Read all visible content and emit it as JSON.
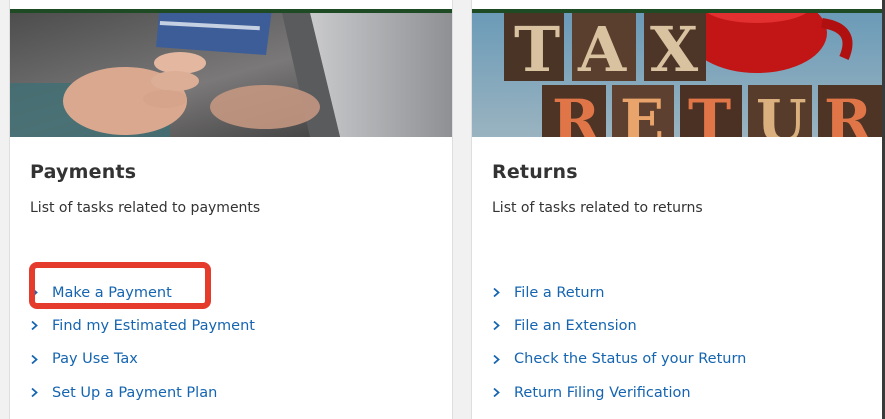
{
  "cards": [
    {
      "title": "Payments",
      "subtitle": "List of tasks related to payments",
      "image": "credit-card-laptop-photo",
      "tasks": [
        {
          "label": "Make a Payment",
          "highlighted": true
        },
        {
          "label": "Find my Estimated Payment"
        },
        {
          "label": "Pay Use Tax"
        },
        {
          "label": "Set Up a Payment Plan"
        }
      ]
    },
    {
      "title": "Returns",
      "subtitle": "List of tasks related to returns",
      "image": "tax-return-wooden-letters-photo",
      "tasks": [
        {
          "label": "File a Return"
        },
        {
          "label": "File an Extension"
        },
        {
          "label": "Check the Status of your Return"
        },
        {
          "label": "Return Filing Verification"
        }
      ]
    }
  ],
  "colors": {
    "link": "#1565b0",
    "highlight": "#e53b2c",
    "accent_bar": "#1e4a24",
    "text": "#333333"
  },
  "icons": {
    "chevron": "chevron-right-icon"
  }
}
